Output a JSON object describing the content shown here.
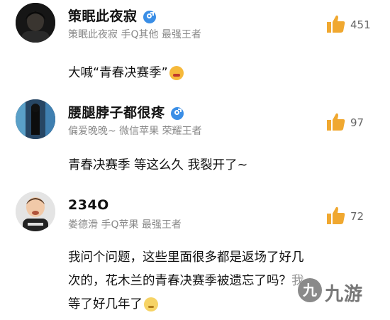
{
  "comments": [
    {
      "username": "策眠此夜寂",
      "meta": "策眠此夜寂  手Q其他  最强王者",
      "likes": "451",
      "text": "大喊“青春决赛季”",
      "emoji": "angry-face-emoji"
    },
    {
      "username": "腰腿脖子都很疼",
      "meta": "偏爱晚晚~  微信苹果  荣耀王者",
      "likes": "97",
      "text": "青春决赛季  等这么久  我裂开了~"
    },
    {
      "username": "234O",
      "meta": "娄德滑  手Q苹果  最强王者",
      "likes": "72",
      "text_lines": [
        "我问个问题，这些里面很多都是返场了好几",
        "次的，花木兰的青春决赛季被遗忘了吗？我",
        "等了好几年了"
      ],
      "emoji": "sleepy-face-emoji"
    }
  ],
  "colors": {
    "like_icon": "#f0a830",
    "verified_badge": "#3a8ee6",
    "meta_text": "#888888"
  },
  "icons": [
    "thumbs-up-icon",
    "verified-icon"
  ],
  "watermark": {
    "logo": "九",
    "text": "九游"
  }
}
